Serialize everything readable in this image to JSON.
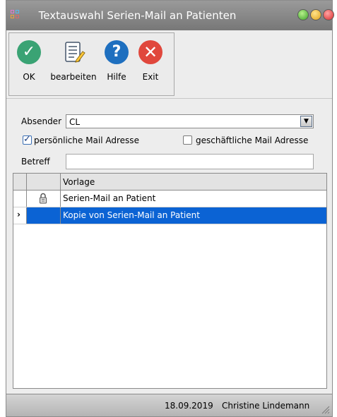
{
  "window": {
    "title": "Textauswahl Serien-Mail an Patienten"
  },
  "toolbar": {
    "ok_label": "OK",
    "edit_label": "bearbeiten",
    "help_label": "Hilfe",
    "exit_label": "Exit"
  },
  "form": {
    "sender_label": "Absender",
    "sender_value": "CL",
    "personal_mail_label": "persönliche Mail Adresse",
    "personal_mail_checked": true,
    "business_mail_label": "geschäftliche Mail Adresse",
    "business_mail_checked": false,
    "subject_label": "Betreff",
    "subject_value": ""
  },
  "grid": {
    "header": "Vorlage",
    "rows": [
      {
        "name": "Serien-Mail an Patient",
        "icon": "lock-icon",
        "selected": false
      },
      {
        "name": "Kopie von Serien-Mail an Patient",
        "icon": "",
        "selected": true
      }
    ]
  },
  "statusbar": {
    "date": "18.09.2019",
    "user": "Christine Lindemann"
  },
  "colors": {
    "ok": "#3aa374",
    "help": "#1e6fbf",
    "exit": "#e0473c",
    "selection": "#0b63d4"
  }
}
